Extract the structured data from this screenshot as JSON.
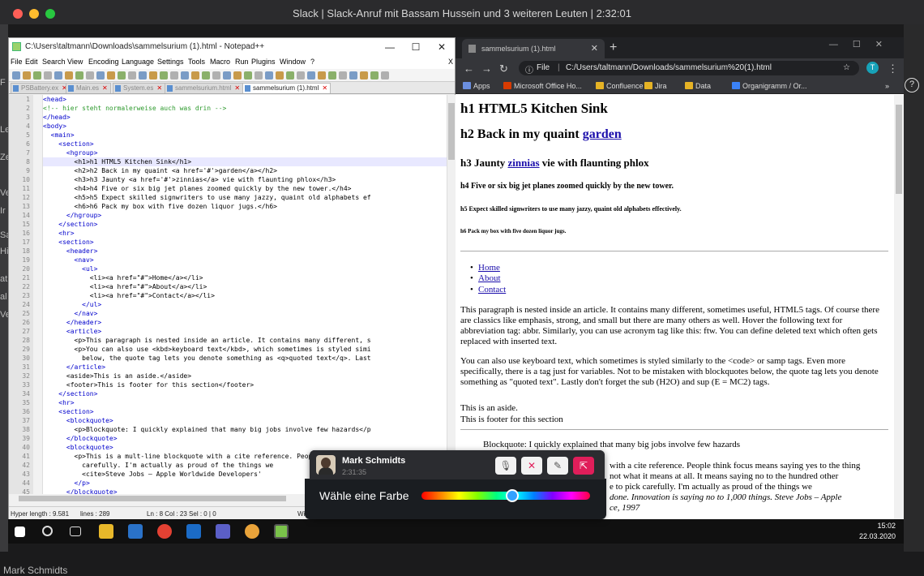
{
  "mac": {
    "title": "Slack | Slack-Anruf mit Bassam Hussein und 3 weiteren Leuten | 2:32:01"
  },
  "slack": {
    "bottom_name": "Mark Schmidts",
    "strip_letters": [
      "F",
      "Le",
      "Ze",
      "Ve",
      "Ir",
      "Sa",
      "Hi",
      "at",
      "al",
      "Ve"
    ]
  },
  "npp": {
    "title": "C:\\Users\\taltmann\\Downloads\\sammelsurium (1).html - Notepad++",
    "winbtns": [
      "—",
      "☐",
      "✕"
    ],
    "menu": [
      "File",
      "Edit",
      "Search",
      "View",
      "Encoding",
      "Language",
      "Settings",
      "Tools",
      "Macro",
      "Run",
      "Plugins",
      "Window",
      "?"
    ],
    "menu_close": "X",
    "tabs": [
      "PSBattery.ex",
      "Main.es",
      "System.es",
      "sammelsurium.html",
      "sammelsurium (1).html"
    ],
    "lines": [
      "<head>",
      "<!-- hier steht normalerweise auch was drin -->",
      "</head>",
      "<body>",
      "  <main>",
      "    <section>",
      "      <hgroup>",
      "        <h1>h1 HTML5 Kitchen Sink</h1>",
      "        <h2>h2 Back in my quaint <a href='#'>garden</a></h2>",
      "        <h3>h3 Jaunty <a href='#'>zinnias</a> vie with flaunting phlox</h3>",
      "        <h4>h4 Five or six big jet planes zoomed quickly by the new tower.</h4>",
      "        <h5>h5 Expect skilled signwriters to use many jazzy, quaint old alphabets ef",
      "        <h6>h6 Pack my box with five dozen liquor jugs.</h6>",
      "      </hgroup>",
      "    </section>",
      "    <hr>",
      "    <section>",
      "      <header>",
      "        <nav>",
      "          <ul>",
      "            <li><a href=\"#\">Home</a></li>",
      "            <li><a href=\"#\">About</a></li>",
      "            <li><a href=\"#\">Contact</a></li>",
      "          </ul>",
      "        </nav>",
      "      </header>",
      "      <article>",
      "        <p>This paragraph is nested inside an article. It contains many different, s",
      "        <p>You can also use <kbd>keyboard text</kbd>, which sometimes is styled simi",
      "          below, the quote tag lets you denote something as <q>quoted text</q>. Last",
      "      </article>",
      "      <aside>This is an aside.</aside>",
      "      <footer>This is footer for this section</footer>",
      "    </section>",
      "    <hr>",
      "    <section>",
      "      <blockquote>",
      "        <p>Blockquote: I quickly explained that many big jobs involve few hazards</p",
      "      </blockquote>",
      "      <blockquote>",
      "        <p>This is a mult-line blockquote with a cite reference. People think focus",
      "          carefully. I'm actually as proud of the things we",
      "          <cite>Steve Jobs – Apple Worldwide Developers'",
      "        </p>",
      "      </blockquote>"
    ],
    "status": {
      "length": "Hyper length : 9.581",
      "lines": "lines : 289",
      "pos": "Ln : 8   Col : 23   Sel : 0 | 0",
      "extra": "Wi"
    }
  },
  "chrome": {
    "tab_title": "sammelsurium (1).html",
    "url_label": "File",
    "url": "C:/Users/taltmann/Downloads/sammelsurium%20(1).html",
    "profile": "T",
    "bookmarks": [
      "Apps",
      "Microsoft Office Ho...",
      "Confluence",
      "Jira",
      "Data",
      "Organigramm / Or..."
    ],
    "page": {
      "h1": "h1 HTML5 Kitchen Sink",
      "h2": "h2 Back in my quaint",
      "h2_link": "garden",
      "h3_a": "h3 Jaunty",
      "h3_link": "zinnias",
      "h3_b": "vie with flaunting phlox",
      "h4": "h4 Five or six big jet planes zoomed quickly by the new tower.",
      "h5": "h5 Expect skilled signwriters to use many jazzy, quaint old alphabets effectively.",
      "h6": "h6 Pack my box with five dozen liquor jugs.",
      "nav": [
        "Home",
        "About",
        "Contact"
      ],
      "p1": "This paragraph is nested inside an article. It contains many different, sometimes useful, HTML5 tags. Of course there are classics like emphasis, strong, and small but there are many others as well. Hover the following text for abbreviation tag: abbr. Similarly, you can use acronym tag like this: ftw. You can define deleted text which often gets replaced with inserted text.",
      "p2": "You can also use keyboard text, which sometimes is styled similarly to the <code> or samp tags. Even more specifically, there is a tag just for variables. Not to be mistaken with blockquotes below, the quote tag lets you denote something as \"quoted text\". Lastly don't forget the sub (H2O) and sup (E = MC2) tags.",
      "aside": "This is an aside.",
      "footer": "This is footer for this section",
      "bq1": "Blockquote: I quickly explained that many big jobs involve few hazards",
      "bq2_lines": [
        "with a cite reference. People think focus means saying yes to the thing",
        "not what it means at all. It means saying no to the hundred other",
        "e to pick carefully. I'm actually as proud of the things we",
        "done. Innovation is saying no to 1,000 things. Steve Jobs – Apple",
        "ce, 1997"
      ]
    }
  },
  "taskbar": {
    "time": "15:02",
    "date": "22.03.2020"
  },
  "call": {
    "name": "Mark Schmidts",
    "time": "2:31:35",
    "buttons": [
      "mic-icon",
      "video-off-icon",
      "draw-icon",
      "screen-share-icon"
    ],
    "color_label": "Wähle eine Farbe",
    "color_value": 0.54
  }
}
